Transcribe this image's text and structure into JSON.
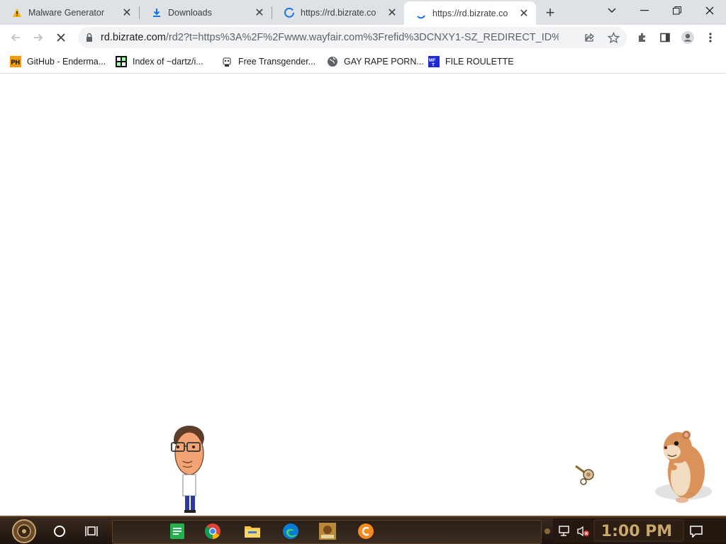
{
  "tabs": [
    {
      "title": "Malware Generator",
      "favicon": "warning-icon",
      "active": false
    },
    {
      "title": "Downloads",
      "favicon": "download-icon",
      "active": false
    },
    {
      "title": "https://rd.bizrate.co",
      "favicon": "loading-spinner-icon",
      "active": false
    },
    {
      "title": "https://rd.bizrate.co",
      "favicon": "loading-spinner-icon",
      "active": true
    }
  ],
  "toolbar": {
    "url_host": "rd.bizrate.com",
    "url_rest": "/rd2?t=https%3A%2F%2Fwww.wayfair.com%3Frefid%3DCNXY1-SZ_REDIRECT_ID%..."
  },
  "bookmarks": [
    {
      "label": "GitHub - Enderma...",
      "icon": "ph-icon"
    },
    {
      "label": "Index of ~dartz/i...",
      "icon": "directory-icon"
    },
    {
      "label": "Free Transgender...",
      "icon": "robot-icon"
    },
    {
      "label": "GAY RAPE PORN...",
      "icon": "globe-icon"
    },
    {
      "label": "FILE ROULETTE",
      "icon": "mft-icon"
    }
  ],
  "taskbar": {
    "clock": "1:00 PM",
    "apps": [
      "spreadsheet-app-icon",
      "chrome-icon",
      "file-explorer-icon",
      "edge-icon",
      "game-app-icon",
      "orange-app-icon"
    ]
  },
  "colors": {
    "tabstrip": "#dee1e6",
    "taskbar": "#2a1d14",
    "clock": "#c9a76a",
    "chrome_blue": "#1a73e8"
  }
}
